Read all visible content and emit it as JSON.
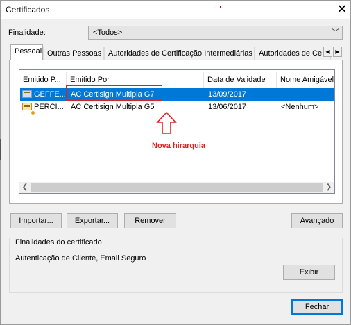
{
  "window": {
    "title": "Certificados"
  },
  "finalidade": {
    "label": "Finalidade:",
    "value": "<Todos>"
  },
  "tabs": [
    {
      "label": "Pessoal"
    },
    {
      "label": "Outras Pessoas"
    },
    {
      "label": "Autoridades de Certificação Intermediárias"
    },
    {
      "label": "Autoridades de Ce"
    }
  ],
  "table": {
    "columns": [
      "Emitido P...",
      "Emitido Por",
      "Data de Validade",
      "Nome Amigável"
    ],
    "rows": [
      {
        "issued_to": "GEFFE...",
        "issued_by": "AC Certisign Multipla G7",
        "expires": "13/09/2017",
        "friendly": ""
      },
      {
        "issued_to": "PERCI...",
        "issued_by": "AC Certisign Multipla G5",
        "expires": "13/06/2017",
        "friendly": "<Nenhum>"
      }
    ]
  },
  "annotation": {
    "text": "Nova hirarquia",
    "color": "#e02020"
  },
  "buttons": {
    "import": "Importar...",
    "export": "Exportar...",
    "remove": "Remover",
    "advanced": "Avançado",
    "view": "Exibir",
    "close": "Fechar"
  },
  "purposes": {
    "title": "Finalidades do certificado",
    "value": "Autenticação de Cliente, Email Seguro"
  },
  "icons": {
    "close": "close-icon",
    "dropdown": "chevron-down-icon",
    "tab_left": "chevron-left-icon",
    "tab_right": "chevron-right-icon",
    "cert": "certificate-icon"
  },
  "colors": {
    "selection": "#0078d7",
    "annotation": "#e02020"
  }
}
